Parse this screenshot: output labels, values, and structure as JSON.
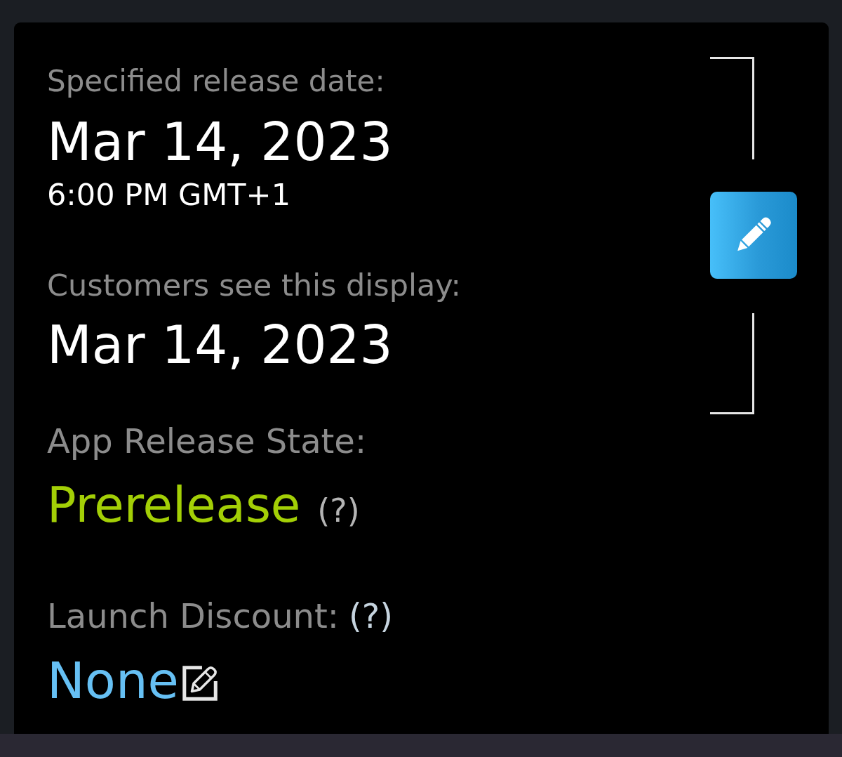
{
  "release_date": {
    "label": "Specified release date:",
    "date": "Mar 14, 2023",
    "time": "6:00 PM GMT+1"
  },
  "customer_display": {
    "label": "Customers see this display:",
    "date": "Mar 14, 2023"
  },
  "release_state": {
    "label": "App Release State:",
    "value": "Prerelease",
    "help": "(?)"
  },
  "launch_discount": {
    "label": "Launch Discount:",
    "help": "(?)",
    "value": "None"
  }
}
